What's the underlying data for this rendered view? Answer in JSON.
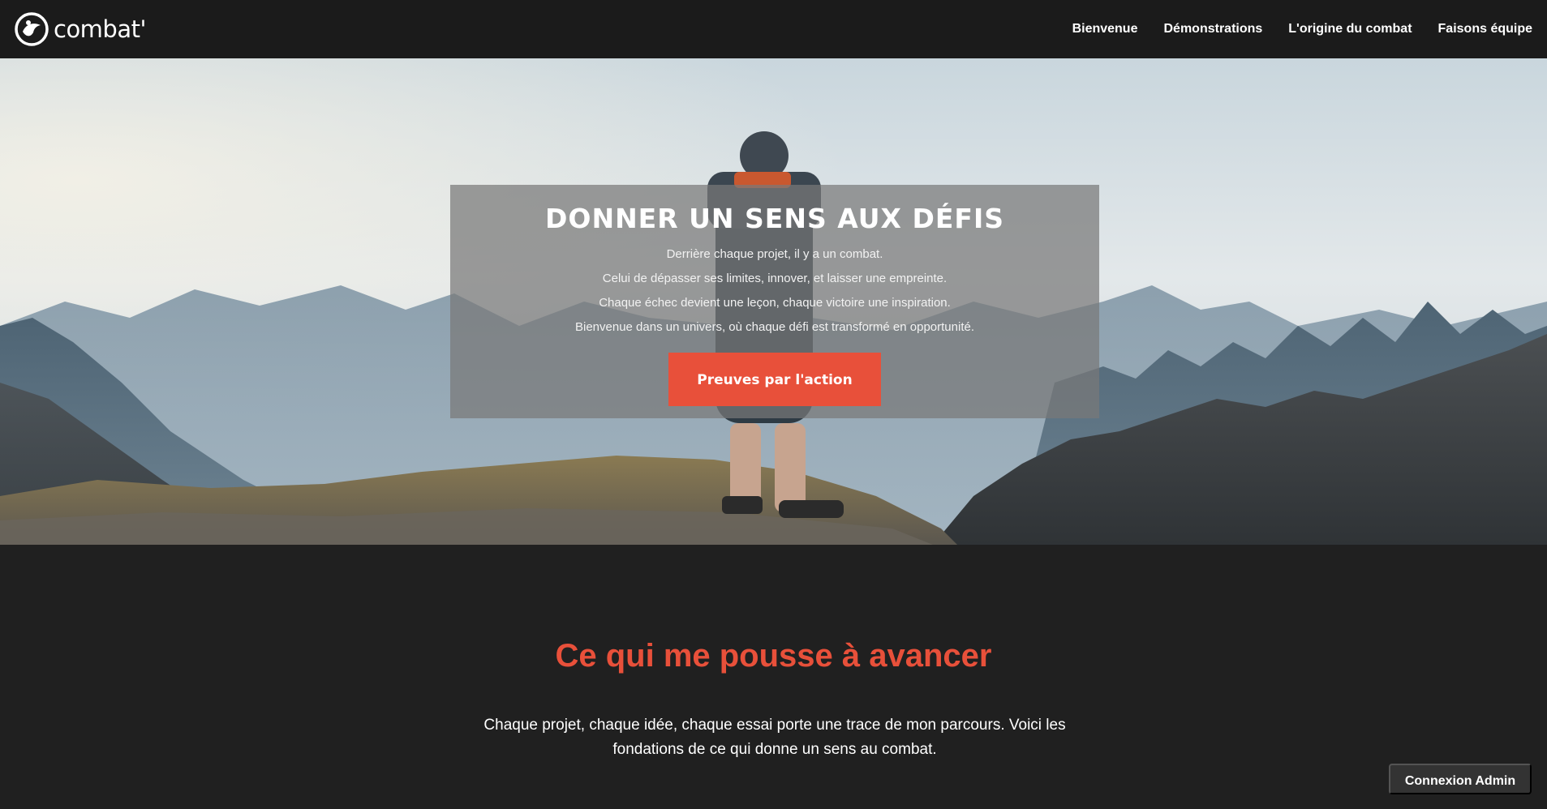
{
  "brand": {
    "name": "combat'"
  },
  "nav": {
    "items": [
      {
        "label": "Bienvenue"
      },
      {
        "label": "Démonstrations"
      },
      {
        "label": "L'origine du combat"
      },
      {
        "label": "Faisons équipe"
      }
    ]
  },
  "hero": {
    "title": "DONNER UN SENS AUX DÉFIS",
    "lines": [
      "Derrière chaque projet, il y a un combat.",
      "Celui de dépasser ses limites, innover, et laisser une empreinte.",
      "Chaque échec devient une leçon, chaque victoire une inspiration.",
      "Bienvenue dans un univers, où chaque défi est transformé en opportunité."
    ],
    "cta_label": "Preuves par l'action"
  },
  "section": {
    "title": "Ce qui me pousse à avancer",
    "text": "Chaque projet, chaque idée, chaque essai porte une trace de mon parcours. Voici les fondations de ce qui donne un sens au combat."
  },
  "admin": {
    "label": "Connexion Admin"
  },
  "colors": {
    "accent": "#e8503a",
    "nav_bg": "#1b1b1b",
    "section_bg": "#202020"
  }
}
